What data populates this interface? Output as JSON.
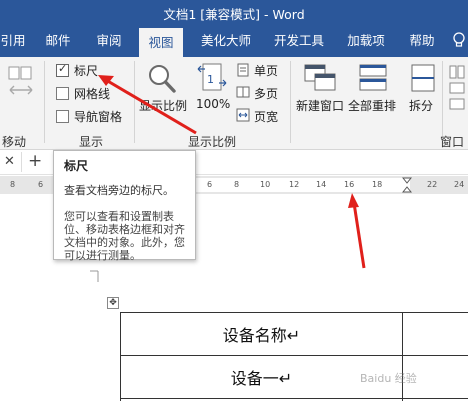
{
  "window": {
    "title": "文档1 [兼容模式] - Word"
  },
  "tabs": [
    {
      "label": "引用"
    },
    {
      "label": "邮件"
    },
    {
      "label": "审阅"
    },
    {
      "label": "视图",
      "active": true
    },
    {
      "label": "美化大师"
    },
    {
      "label": "开发工具"
    },
    {
      "label": "加载项"
    },
    {
      "label": "帮助"
    }
  ],
  "ribbon": {
    "move_group": {
      "label": "移动"
    },
    "show_group": {
      "label": "显示",
      "ruler": {
        "label": "标尺",
        "checked": true
      },
      "gridlines": {
        "label": "网格线",
        "checked": false
      },
      "nav_pane": {
        "label": "导航窗格",
        "checked": false
      }
    },
    "zoom_group": {
      "label": "显示比例",
      "zoom_button": "显示比例",
      "zoom100_button": "100%",
      "one_page": "单页",
      "multi_page": "多页",
      "page_width": "页宽"
    },
    "window_group": {
      "label": "窗口",
      "new_window": "新建窗口",
      "arrange_all": "全部重排",
      "split": "拆分"
    }
  },
  "docbar": {
    "close": "✕",
    "add": "+"
  },
  "ruler": {
    "left_ticks": [
      "8",
      "6"
    ],
    "right_ticks": [
      "6",
      "8",
      "10",
      "12",
      "14",
      "16",
      "18",
      "22",
      "24"
    ]
  },
  "tooltip": {
    "title": "标尺",
    "subtitle": "查看文档旁边的标尺。",
    "description": "您可以查看和设置制表位、移动表格边框和对齐文档中的对象。此外，您可以进行测量。"
  },
  "document": {
    "table_move_handle": "✥",
    "rows": [
      {
        "cell": "设备名称↵"
      },
      {
        "cell": "设备一↵"
      }
    ]
  },
  "watermark": "Baidu 经验",
  "colors": {
    "word_blue": "#2b579a",
    "arrow_red": "#e0201b",
    "ribbon_bg": "#f3f3f3"
  }
}
